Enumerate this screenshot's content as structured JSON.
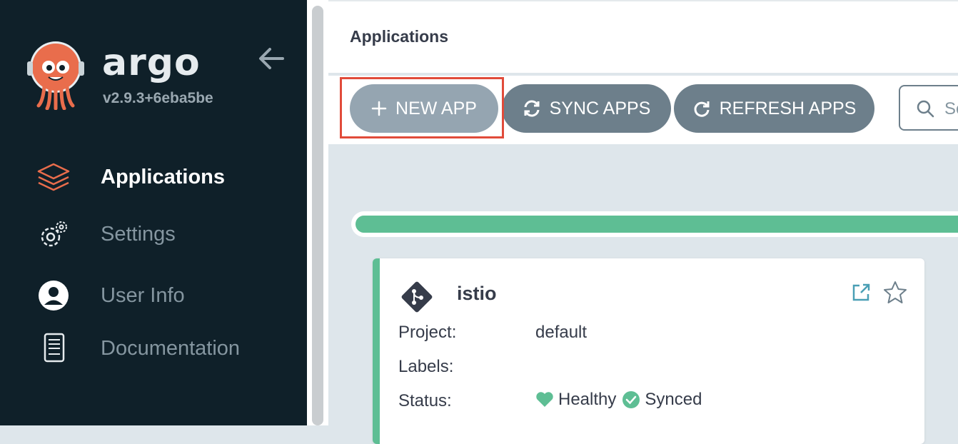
{
  "sidebar": {
    "brand": "argo",
    "version": "v2.9.3+6eba5be",
    "items": [
      {
        "label": "Applications",
        "icon": "layers-icon",
        "active": true
      },
      {
        "label": "Settings",
        "icon": "gear-icon",
        "active": false
      },
      {
        "label": "User Info",
        "icon": "user-icon",
        "active": false
      },
      {
        "label": "Documentation",
        "icon": "book-icon",
        "active": false
      }
    ]
  },
  "header": {
    "title": "Applications"
  },
  "toolbar": {
    "new_app": "NEW APP",
    "sync_apps": "SYNC APPS",
    "refresh_apps": "REFRESH APPS",
    "search_placeholder": "Se"
  },
  "app_card": {
    "name": "istio",
    "project_key": "Project:",
    "project_value": "default",
    "labels_key": "Labels:",
    "labels_value": "",
    "status_key": "Status:",
    "health": "Healthy",
    "sync": "Synced"
  },
  "colors": {
    "sidebar_bg": "#0f2029",
    "accent_green": "#5ebe94",
    "button_gray": "#6d7f8b",
    "highlight_red": "#e14b3a"
  }
}
